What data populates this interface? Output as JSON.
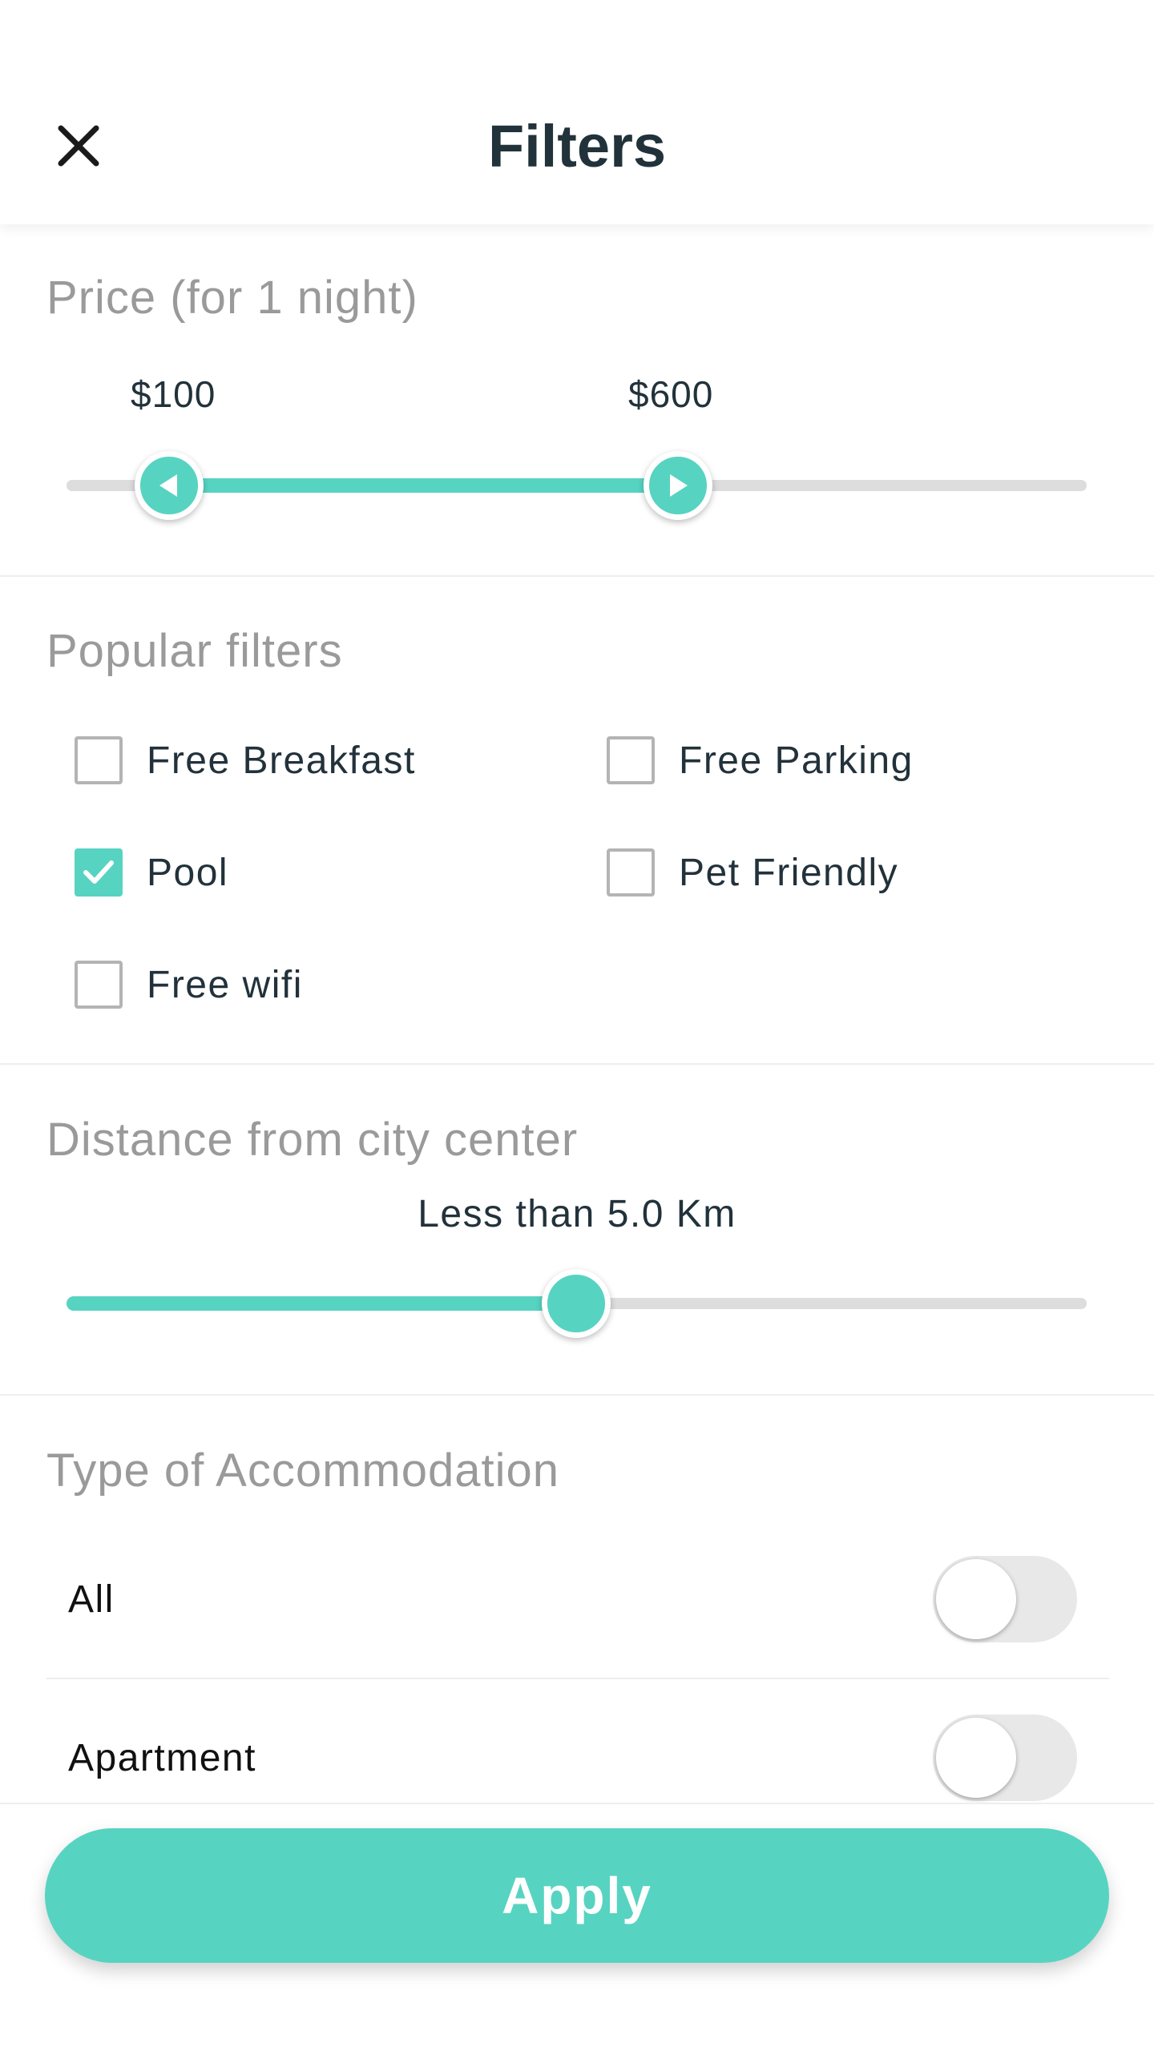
{
  "header": {
    "title": "Filters",
    "close_icon": "close-icon"
  },
  "price": {
    "title": "Price (for 1 night)",
    "min_label": "$100",
    "max_label": "$600",
    "range_min_fraction": 0.1,
    "range_max_fraction": 0.6
  },
  "popular": {
    "title": "Popular filters",
    "items": [
      {
        "label": "Free Breakfast",
        "checked": false
      },
      {
        "label": "Free Parking",
        "checked": false
      },
      {
        "label": "Pool",
        "checked": true
      },
      {
        "label": "Pet Friendly",
        "checked": false
      },
      {
        "label": "Free wifi",
        "checked": false
      }
    ]
  },
  "distance": {
    "title": "Distance from city center",
    "value_label": "Less than 5.0 Km",
    "level_fraction": 0.5
  },
  "accommodation": {
    "title": "Type of Accommodation",
    "items": [
      {
        "label": "All",
        "on": false
      },
      {
        "label": "Apartment",
        "on": false
      }
    ]
  },
  "footer": {
    "apply_label": "Apply"
  },
  "colors": {
    "accent": "#57d3c1",
    "text_dark": "#22323b",
    "text_muted": "#9a9a9a"
  }
}
